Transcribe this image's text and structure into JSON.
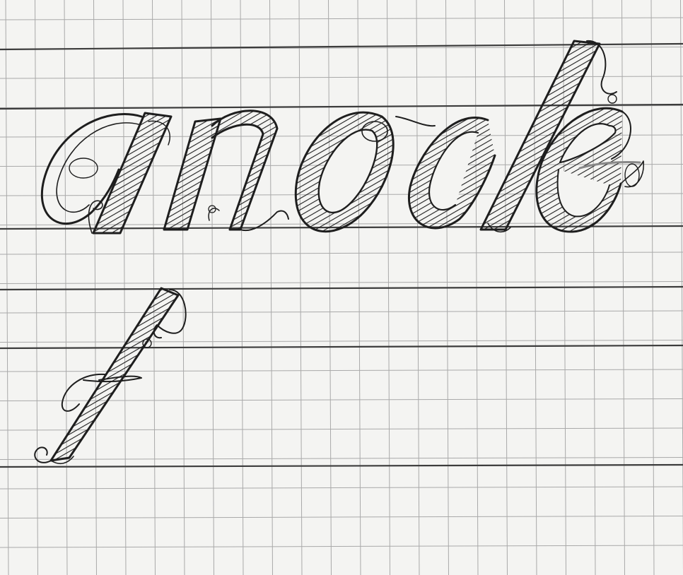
{
  "sheet": {
    "paper_color": "#f4f4f2",
    "grid_color": "#a9a9a9",
    "guideline_color": "#3c3c3c",
    "ink_color": "#1e1e1e"
  },
  "drawing": {
    "word": "anode",
    "letters": [
      "a",
      "n",
      "o",
      "d",
      "e"
    ],
    "second_letter": "f",
    "style": "hand-sketched shaded script lettering on grid paper"
  }
}
